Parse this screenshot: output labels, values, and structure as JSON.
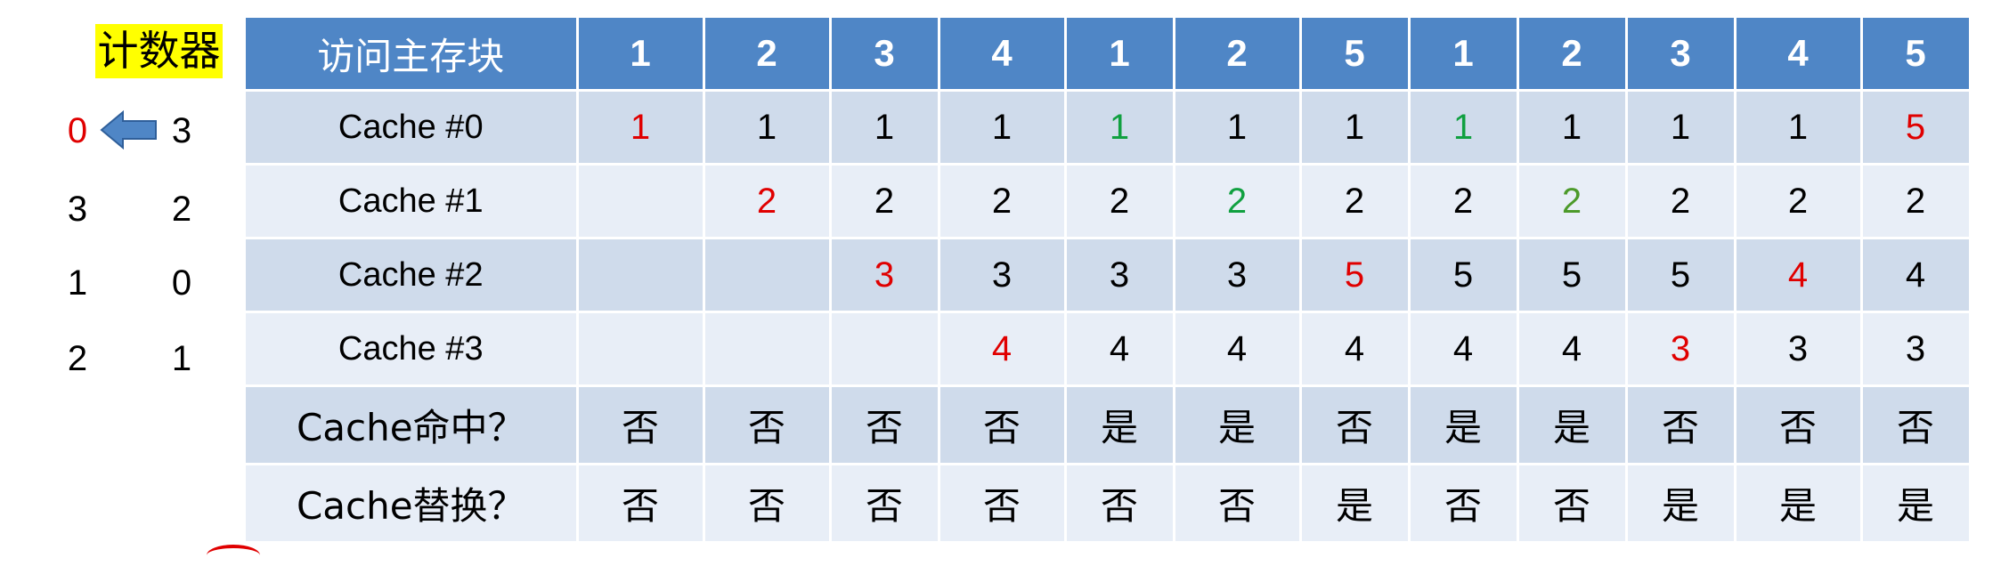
{
  "counter": {
    "title": "计数器",
    "left_column": [
      "0",
      "3",
      "1",
      "2"
    ],
    "right_column": [
      "3",
      "2",
      "0",
      "1"
    ],
    "arrow_icon": "left-arrow-icon",
    "colors": {
      "highlight": "#ffff00",
      "red": "#e00000",
      "arrow": "#4f86c6"
    }
  },
  "table": {
    "header_label": "访问主存块",
    "access_sequence": [
      "1",
      "2",
      "3",
      "4",
      "1",
      "2",
      "5",
      "1",
      "2",
      "3",
      "4",
      "5"
    ],
    "rows": [
      {
        "label": "Cache #0",
        "cells": [
          {
            "v": "1",
            "c": "red"
          },
          {
            "v": "1",
            "c": ""
          },
          {
            "v": "1",
            "c": ""
          },
          {
            "v": "1",
            "c": ""
          },
          {
            "v": "1",
            "c": "green"
          },
          {
            "v": "1",
            "c": ""
          },
          {
            "v": "1",
            "c": ""
          },
          {
            "v": "1",
            "c": "green"
          },
          {
            "v": "1",
            "c": ""
          },
          {
            "v": "1",
            "c": ""
          },
          {
            "v": "1",
            "c": ""
          },
          {
            "v": "5",
            "c": "red"
          }
        ]
      },
      {
        "label": "Cache #1",
        "cells": [
          {
            "v": "",
            "c": ""
          },
          {
            "v": "2",
            "c": "red"
          },
          {
            "v": "2",
            "c": ""
          },
          {
            "v": "2",
            "c": ""
          },
          {
            "v": "2",
            "c": ""
          },
          {
            "v": "2",
            "c": "green"
          },
          {
            "v": "2",
            "c": ""
          },
          {
            "v": "2",
            "c": ""
          },
          {
            "v": "2",
            "c": "olive"
          },
          {
            "v": "2",
            "c": ""
          },
          {
            "v": "2",
            "c": ""
          },
          {
            "v": "2",
            "c": ""
          }
        ]
      },
      {
        "label": "Cache #2",
        "cells": [
          {
            "v": "",
            "c": ""
          },
          {
            "v": "",
            "c": ""
          },
          {
            "v": "3",
            "c": "red"
          },
          {
            "v": "3",
            "c": ""
          },
          {
            "v": "3",
            "c": ""
          },
          {
            "v": "3",
            "c": ""
          },
          {
            "v": "5",
            "c": "red"
          },
          {
            "v": "5",
            "c": ""
          },
          {
            "v": "5",
            "c": ""
          },
          {
            "v": "5",
            "c": ""
          },
          {
            "v": "4",
            "c": "red"
          },
          {
            "v": "4",
            "c": ""
          }
        ]
      },
      {
        "label": "Cache #3",
        "cells": [
          {
            "v": "",
            "c": ""
          },
          {
            "v": "",
            "c": ""
          },
          {
            "v": "",
            "c": ""
          },
          {
            "v": "4",
            "c": "red"
          },
          {
            "v": "4",
            "c": ""
          },
          {
            "v": "4",
            "c": ""
          },
          {
            "v": "4",
            "c": ""
          },
          {
            "v": "4",
            "c": ""
          },
          {
            "v": "4",
            "c": ""
          },
          {
            "v": "3",
            "c": "red"
          },
          {
            "v": "3",
            "c": ""
          },
          {
            "v": "3",
            "c": ""
          }
        ]
      }
    ],
    "hit_row": {
      "label": "Cache命中？",
      "values": [
        "否",
        "否",
        "否",
        "否",
        "是",
        "是",
        "否",
        "是",
        "是",
        "否",
        "否",
        "否"
      ]
    },
    "replace_row": {
      "label": "Cache替换？",
      "values": [
        "否",
        "否",
        "否",
        "否",
        "否",
        "否",
        "是",
        "否",
        "否",
        "是",
        "是",
        "是"
      ]
    },
    "colors": {
      "header_bg": "#4f86c6",
      "row_dark": "#cfdbeb",
      "row_light": "#e8eef7",
      "red": "#e00000",
      "green": "#10a040",
      "olive": "#4c9a2a"
    }
  }
}
